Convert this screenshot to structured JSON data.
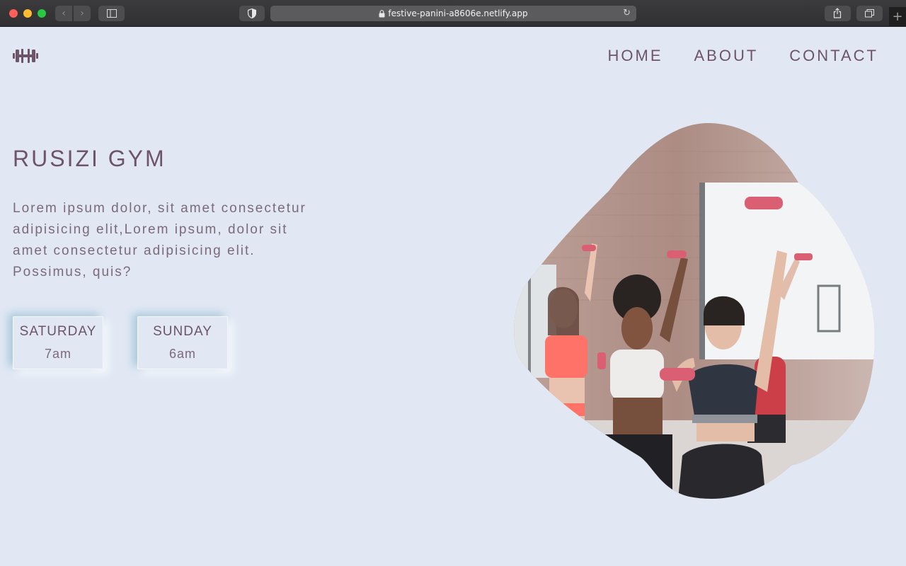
{
  "browser": {
    "url": "festive-panini-a8606e.netlify.app"
  },
  "nav": {
    "items": [
      {
        "label": "HOME"
      },
      {
        "label": "ABOUT"
      },
      {
        "label": "CONTACT"
      }
    ]
  },
  "hero": {
    "title": "RUSIZI GYM",
    "text": "Lorem ipsum dolor, sit amet consectetur adipisicing elit,Lorem ipsum, dolor sit amet consectetur adipisicing elit. Possimus, quis?",
    "schedule": [
      {
        "day": "SATURDAY",
        "time": "7am"
      },
      {
        "day": "SUNDAY",
        "time": "6am"
      }
    ]
  },
  "icons": {
    "logo": "dumbbell-icon"
  },
  "colors": {
    "background": "#e1e8f4",
    "accent": "#6d5468",
    "text": "#7c6a7a"
  }
}
